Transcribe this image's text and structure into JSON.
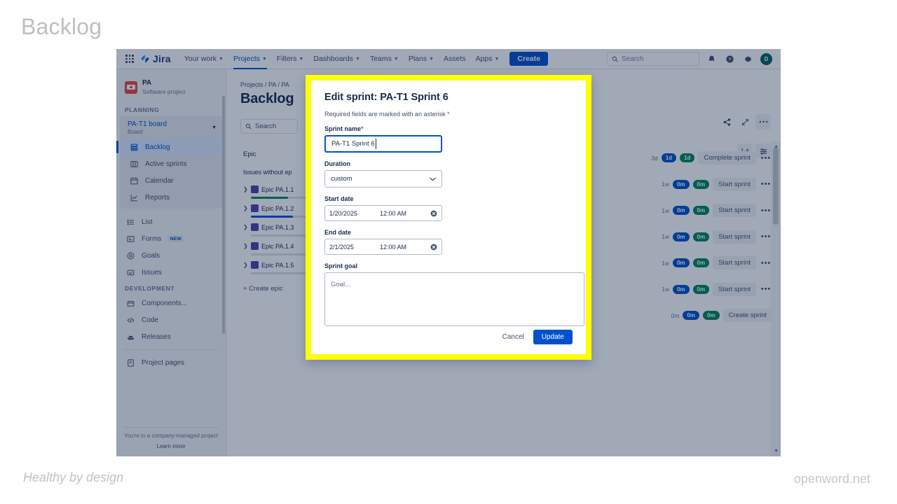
{
  "slide": {
    "title": "Backlog",
    "footer_left": "Healthy by design",
    "footer_right": "openword.net"
  },
  "topnav": {
    "logo_text": "Jira",
    "items": [
      {
        "label": "Your work",
        "has_caret": true,
        "active": false
      },
      {
        "label": "Projects",
        "has_caret": true,
        "active": true
      },
      {
        "label": "Filters",
        "has_caret": true,
        "active": false
      },
      {
        "label": "Dashboards",
        "has_caret": true,
        "active": false
      },
      {
        "label": "Teams",
        "has_caret": true,
        "active": false
      },
      {
        "label": "Plans",
        "has_caret": true,
        "active": false
      },
      {
        "label": "Assets",
        "has_caret": false,
        "active": false
      },
      {
        "label": "Apps",
        "has_caret": true,
        "active": false
      }
    ],
    "create_label": "Create",
    "search_placeholder": "Search",
    "avatar_initial": "D",
    "avatar_color": "#00675b",
    "create_color": "#0052cc"
  },
  "sidebar": {
    "project_name": "PA",
    "project_type": "Software project",
    "planning_label": "PLANNING",
    "board_name": "PA-T1 board",
    "board_sub": "Board",
    "planning_items": [
      {
        "label": "Backlog",
        "icon": "backlog-icon",
        "selected": true
      },
      {
        "label": "Active sprints",
        "icon": "board-columns-icon",
        "selected": false
      },
      {
        "label": "Calendar",
        "icon": "calendar-icon",
        "selected": false
      },
      {
        "label": "Reports",
        "icon": "reports-chart-icon",
        "selected": false
      }
    ],
    "other_items": [
      {
        "label": "List",
        "icon": "list-icon",
        "badge": ""
      },
      {
        "label": "Forms",
        "icon": "forms-icon",
        "badge": "NEW"
      },
      {
        "label": "Goals",
        "icon": "goals-target-icon",
        "badge": ""
      },
      {
        "label": "Issues",
        "icon": "issues-icon",
        "badge": ""
      }
    ],
    "development_label": "DEVELOPMENT",
    "development_items": [
      {
        "label": "Components...",
        "icon": "components-icon"
      },
      {
        "label": "Code",
        "icon": "code-icon"
      },
      {
        "label": "Releases",
        "icon": "releases-ship-icon"
      }
    ],
    "bottom_items": [
      {
        "label": "Project pages",
        "icon": "project-pages-icon"
      }
    ],
    "footer_note": "You're in a company-managed project",
    "footer_link": "Learn more"
  },
  "content": {
    "breadcrumb": "Projects / PA / PA",
    "page_title": "Backlog",
    "search_placeholder": "Search",
    "epic_panel": {
      "header": "Epic",
      "issues_without_epic": "Issues without ep",
      "epics": [
        {
          "name": "Epic PA.1.1",
          "progress": 62,
          "color": "#00875a"
        },
        {
          "name": "Epic PA.1.2",
          "progress": 70,
          "color": "#0052cc"
        },
        {
          "name": "Epic PA.1.3",
          "progress": 0,
          "color": "#dfe1e6"
        },
        {
          "name": "Epic PA.1.4",
          "progress": 0,
          "color": "#dfe1e6"
        },
        {
          "name": "Epic PA.1.5",
          "progress": 0,
          "color": "#dfe1e6"
        }
      ],
      "create_epic_label": "+ Create epic"
    },
    "sprint_rows": [
      {
        "days": "3d",
        "blue": "1d",
        "green": "1d",
        "action": "Complete sprint"
      },
      {
        "days": "1w",
        "blue": "0m",
        "green": "0m",
        "action": "Start sprint"
      },
      {
        "days": "1w",
        "blue": "0m",
        "green": "0m",
        "action": "Start sprint"
      },
      {
        "days": "1w",
        "blue": "0m",
        "green": "0m",
        "action": "Start sprint"
      },
      {
        "days": "1w",
        "blue": "0m",
        "green": "0m",
        "action": "Start sprint"
      },
      {
        "days": "1w",
        "blue": "0m",
        "green": "0m",
        "action": "Start sprint"
      },
      {
        "days": "0m",
        "blue": "0m",
        "green": "0m",
        "action": "Create sprint"
      }
    ]
  },
  "modal": {
    "title": "Edit sprint: PA-T1 Sprint 6",
    "required_note": "Required fields are marked with an asterisk",
    "sprint_name_label": "Sprint name",
    "sprint_name_value": "PA-T1 Sprint 6",
    "duration_label": "Duration",
    "duration_value": "custom",
    "start_date_label": "Start date",
    "start_date_value": "1/20/2025",
    "start_time_value": "12:00 AM",
    "end_date_label": "End date",
    "end_date_value": "2/1/2025",
    "end_time_value": "12:00 AM",
    "sprint_goal_label": "Sprint goal",
    "sprint_goal_placeholder": "Goal...",
    "cancel_label": "Cancel",
    "update_label": "Update",
    "highlight_color": "#ffff00",
    "primary_color": "#0052cc"
  }
}
